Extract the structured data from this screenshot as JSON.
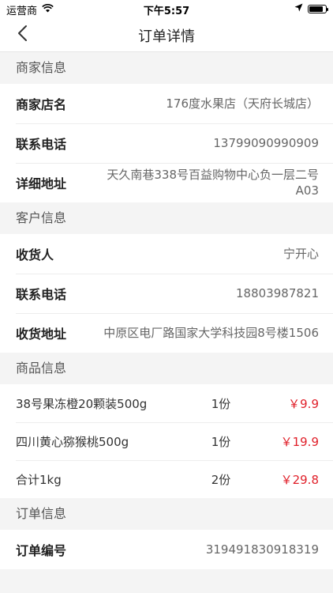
{
  "status_bar": {
    "carrier": "运营商",
    "time": "下午5:57"
  },
  "nav": {
    "title": "订单详情",
    "back_icon": "chevron-left-icon"
  },
  "merchant": {
    "header": "商家信息",
    "rows": [
      {
        "label": "商家店名",
        "value": "176度水果店（天府长城店）"
      },
      {
        "label": "联系电话",
        "value": "13799090990909"
      },
      {
        "label": "详细地址",
        "value": "天久南巷338号百益购物中心负一层二号A03"
      }
    ]
  },
  "customer": {
    "header": "客户信息",
    "rows": [
      {
        "label": "收货人",
        "value": "宁开心"
      },
      {
        "label": "联系电话",
        "value": "18803987821"
      },
      {
        "label": "收货地址",
        "value": "中原区电厂路国家大学科技园8号楼1506"
      }
    ]
  },
  "goods": {
    "header": "商品信息",
    "price_color": "#e0202a",
    "items": [
      {
        "name": "38号果冻橙20颗装500g",
        "qty": "1份",
        "price": "￥9.9"
      },
      {
        "name": "四川黄心猕猴桃500g",
        "qty": "1份",
        "price": "￥19.9"
      },
      {
        "name": "合计1kg",
        "qty": "2份",
        "price": "￥29.8"
      }
    ]
  },
  "order": {
    "header": "订单信息",
    "rows": [
      {
        "label": "订单编号",
        "value": "319491830918319"
      }
    ]
  }
}
